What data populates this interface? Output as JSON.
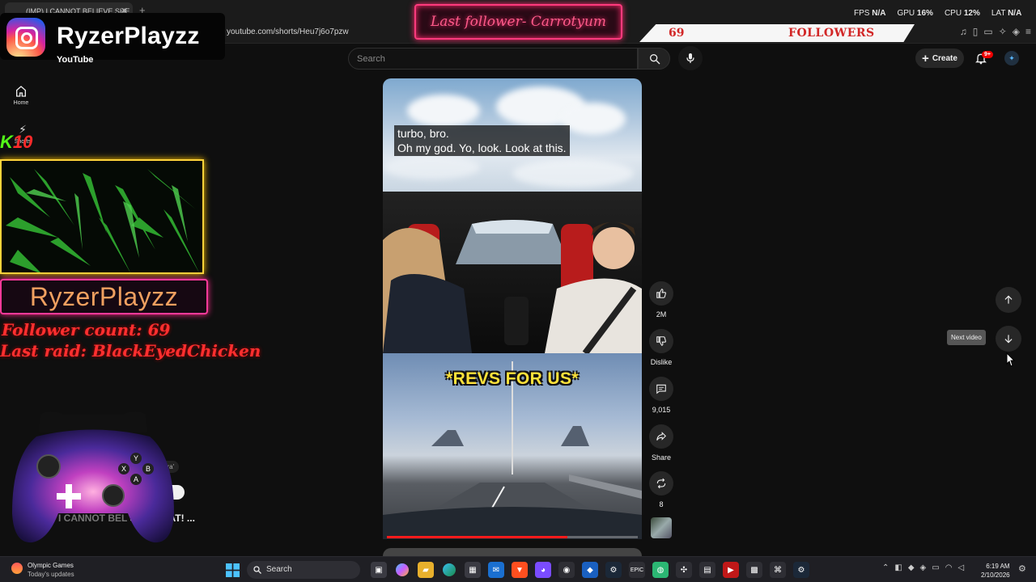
{
  "browser": {
    "tab_title": "(IMP) I CANNOT BELIEVE SHE",
    "url": "youtube.com/shorts/Heu7j6o7pzw"
  },
  "perf": {
    "fps_label": "FPS",
    "fps_value": "N/A",
    "gpu_label": "GPU",
    "gpu_value": "16%",
    "cpu_label": "CPU",
    "cpu_value": "12%",
    "lat_label": "LAT",
    "lat_value": "N/A"
  },
  "overlay": {
    "instagram_handle": "RyzerPlayzz",
    "last_follower": "Last follower- Carrotyum",
    "followers_number": "69",
    "followers_label": "FOLLOWERS",
    "kick_count": "10",
    "streamer_name": "RyzerPlayzz",
    "follower_count_text": "Follower count: 69",
    "last_raid_text": "Last raid: BlackEyedChicken"
  },
  "youtube": {
    "logo_text": "YouTube",
    "search_placeholder": "Search",
    "create_label": "Create",
    "notif_badge": "9+",
    "sidebar": [
      {
        "label": "Home",
        "icon": "home-icon"
      },
      {
        "label": "Shorts",
        "icon": "shorts-icon"
      }
    ],
    "residual_chip": "pra'",
    "residual_title_dim": "I CANNOT BEL",
    "residual_title": "SAID THAT! ..."
  },
  "video": {
    "subtitle_line1": "turbo, bro.",
    "subtitle_line2": "Oh my god. Yo, look. Look at this.",
    "caption": "*REVS FOR US*",
    "progress": 0.72
  },
  "actions": {
    "like_count": "2M",
    "dislike_label": "Dislike",
    "comment_count": "9,015",
    "share_label": "Share",
    "remix_count": "8"
  },
  "nav": {
    "tooltip": "Next video"
  },
  "controller": {
    "button_y": "Y",
    "button_x": "X",
    "button_b": "B",
    "button_a": "A"
  },
  "taskbar": {
    "weather_title": "Olympic Games",
    "weather_sub": "Today's updates",
    "search_label": "Search",
    "time": "6:19 AM",
    "date": "2/10/2026"
  }
}
